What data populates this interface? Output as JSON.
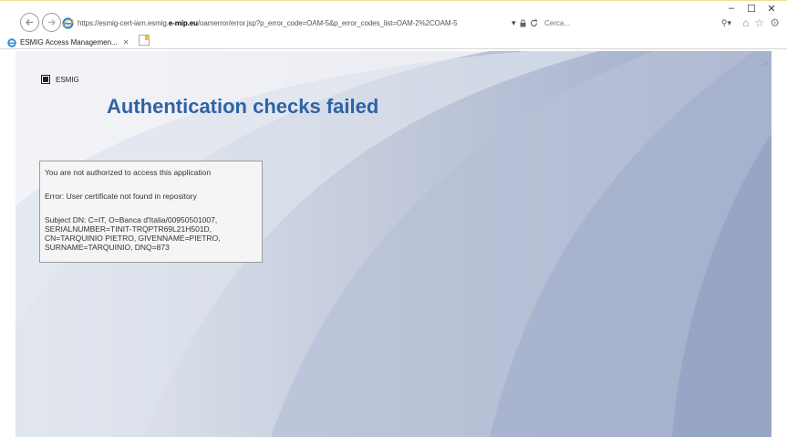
{
  "browser": {
    "url_prefix": "https://esmig-cert-iam.esmig.",
    "url_host": "e-mip.eu",
    "url_path": "/oamerror/error.jsp?p_error_code=OAM-5&p_error_codes_list=OAM-2%2COAM-5",
    "search_placeholder": "Cerca...",
    "tab_title": "ESMIG Access Managemen...",
    "win_minimize": "–",
    "win_maximize": "☐",
    "win_close": "✕",
    "tab_close": "✕"
  },
  "page": {
    "logo_text": "ESMIG",
    "title": "Authentication checks failed",
    "message": "You are not authorized to access this application",
    "error_line": "Error: User certificate not found in repository",
    "subject_dn": "Subject DN: C=IT, O=Banca d'Italia/00950501007, SERIALNUMBER=TINIT-TRQPTR69L21H501D, CN=TARQUINIO PIETRO, GIVENNAME=PIETRO, SURNAME=TARQUINIO, DNQ=873"
  },
  "colors": {
    "title": "#2f63a6",
    "background_light": "#dfe4ee",
    "background_dark": "#8f9ec0"
  },
  "icons": {
    "back": "arrow-left-icon",
    "forward": "arrow-right-icon",
    "ie": "internet-explorer-icon",
    "lock": "lock-icon",
    "refresh": "refresh-icon",
    "search": "search-icon",
    "home": "home-icon",
    "favorites": "star-icon",
    "settings": "gear-icon"
  }
}
